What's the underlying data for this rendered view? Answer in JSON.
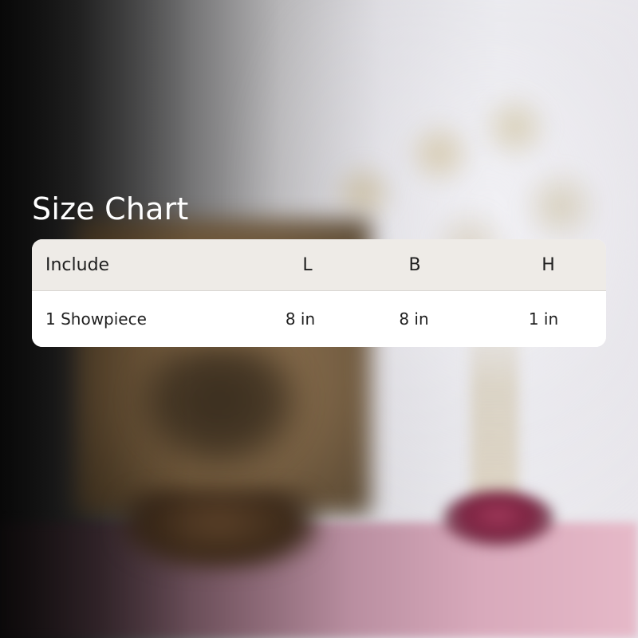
{
  "title": "Size Chart",
  "table": {
    "headers": {
      "item": "Include",
      "length": "L",
      "breadth": "B",
      "height": "H"
    },
    "rows": [
      {
        "item": "1 Showpiece",
        "length": "8 in",
        "breadth": "8 in",
        "height": "1 in"
      }
    ]
  }
}
